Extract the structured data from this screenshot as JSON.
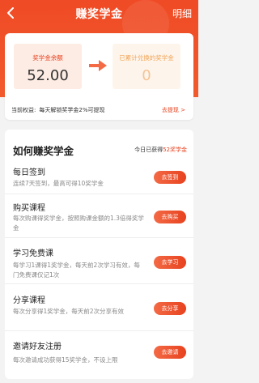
{
  "header": {
    "title": "赚奖学金",
    "detail_label": "明细"
  },
  "balance": {
    "balance_label": "奖学金余额",
    "balance_value": "52.00",
    "redeemed_label": "已累计兑换的奖学金",
    "redeemed_value": "0",
    "rights_label": "当前权益:",
    "rights_text": "每天解锁奖学金2%可提现",
    "withdraw_link": "去提现 >"
  },
  "how": {
    "title": "如何赚奖学金",
    "today_prefix": "今日已获得",
    "today_value": "52奖学金"
  },
  "tasks": [
    {
      "name": "每日签到",
      "desc": "连续7天签到，最高可得10奖学金",
      "button": "去签到"
    },
    {
      "name": "购买课程",
      "desc": "每次购课得奖学金，按照购课金额的1.3倍得奖学金",
      "button": "去购买"
    },
    {
      "name": "学习免费课",
      "desc": "每学习1课得1奖学金，每天前2次学习有效，每门免费课仅记1次",
      "button": "去学习"
    },
    {
      "name": "分享课程",
      "desc": "每次分享得1奖学金，每天前2次分享有效",
      "button": "去分享"
    },
    {
      "name": "邀请好友注册",
      "desc": "每次邀请成功获得15奖学金，不设上限",
      "button": "去邀请"
    }
  ],
  "colors": {
    "primary": "#e8421f",
    "header_bg": "#ef4b26",
    "accent_orange": "#f2a355"
  },
  "icons": {
    "back": "back-arrow-icon",
    "arrow": "right-arrow-icon"
  }
}
